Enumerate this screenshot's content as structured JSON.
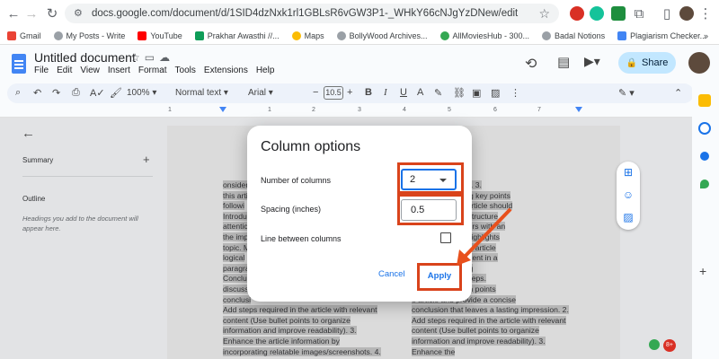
{
  "browser": {
    "url": "docs.google.com/document/d/1SID4dzNxk1rl1GBLsR6vGW3P1-_WHkY66cNJgYzDNew/edit",
    "bookmarks": [
      "Gmail",
      "My Posts - Write",
      "YouTube",
      "Prakhar Awasthi //...",
      "Maps",
      "BollyWood Archives...",
      "AllMoviesHub - 300...",
      "Badal Notions",
      "Plagiarism Checker..."
    ],
    "colors": {
      "accent": "#1a73e8",
      "share_bg": "#c2e7ff",
      "highlight_red": "#d9431b"
    }
  },
  "docs": {
    "title": "Untitled document",
    "menu": [
      "File",
      "Edit",
      "View",
      "Insert",
      "Format",
      "Tools",
      "Extensions",
      "Help"
    ],
    "share_label": "Share",
    "toolbar": {
      "zoom": "100%",
      "style": "Normal text",
      "font": "Arial",
      "font_size": "10.5"
    },
    "ruler_ticks": [
      "1",
      "1",
      "2",
      "3",
      "4",
      "5",
      "6",
      "7"
    ]
  },
  "outline": {
    "summary_label": "Summary",
    "outline_label": "Outline",
    "hint": "Headings you add to the document will appear here."
  },
  "page": {
    "left_column": [
      "onsider",
      "this arti",
      "followi",
      "Introduc",
      "attentic",
      "the imp",
      "topic. M",
      "logical",
      "paragra",
      "Conclus",
      "discuss",
      "conclusi",
      "Add steps required in the article with relevant",
      "content (Use bullet points to organize",
      "information and improve readability). 3.",
      "Enhance the article information by",
      "incorporating relatable images/screenshots. 4."
    ],
    "right_column": [
      "prove readability). 3.",
      "sider the following key points",
      "e article: 1. The article should",
      "ng Basic Article Structure",
      "ction: Hook readers with an",
      "ntroduction that highlights",
      "d relevance of the article",
      "Present your content in a",
      "ent manner, using",
      "parate different steps.",
      "mmarize the main points",
      "e article and provide a concise",
      "conclusion that leaves a lasting impression. 2.",
      "Add steps required in the article with relevant",
      "content (Use bullet points to organize",
      "information and improve readability). 3.",
      "Enhance the"
    ]
  },
  "dialog": {
    "title": "Column options",
    "columns_label": "Number of columns",
    "columns_value": "2",
    "spacing_label": "Spacing (inches)",
    "spacing_value": "0.5",
    "line_label": "Line between columns",
    "cancel_label": "Cancel",
    "apply_label": "Apply"
  },
  "badges": {
    "notifications": "8+"
  }
}
